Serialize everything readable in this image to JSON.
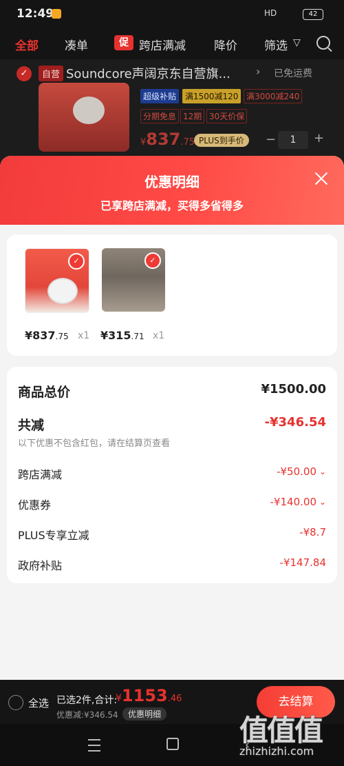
{
  "status": {
    "time": "12:49",
    "signal": "HD",
    "battery": "42"
  },
  "tabs": {
    "all": "全部",
    "combine": "凑单",
    "promo_badge": "促",
    "cross_store": "跨店满减",
    "price_drop": "降价",
    "filter": "筛选"
  },
  "background_item": {
    "self_tag": "自营",
    "shop_name": "Soundcore声阔京东自营旗...",
    "shipping": "已免运费",
    "tags": [
      "超级补贴",
      "满1500减120",
      "满3000减240",
      "分期免息",
      "12期",
      "30天价保"
    ],
    "price_symbol": "¥",
    "price_int": "837",
    "price_dec": ".75",
    "plus_badge": "PLUS到手价",
    "qty": "1",
    "minus": "−",
    "plus": "+"
  },
  "sheet": {
    "title": "优惠明细",
    "subtitle": "已享跨店满减，买得多省得多",
    "products": [
      {
        "price_main": "¥837",
        "price_dec": ".75",
        "qty": "x1"
      },
      {
        "price_main": "¥315",
        "price_dec": ".71",
        "qty": "x1"
      }
    ],
    "summary": {
      "total_label": "商品总价",
      "total_value": "¥1500.00",
      "reduce_label": "共减",
      "reduce_value": "-¥346.54",
      "note": "以下优惠不包含红包，请在结算页查看",
      "items": [
        {
          "label": "跨店满减",
          "value": "-¥50.00"
        },
        {
          "label": "优惠券",
          "value": "-¥140.00"
        },
        {
          "label": "PLUS专享立减",
          "value": "-¥8.7"
        },
        {
          "label": "政府补贴",
          "value": "-¥147.84"
        }
      ]
    }
  },
  "bottom": {
    "select_all": "全选",
    "selected_text": "已选2件,合计:",
    "total_symbol": "¥",
    "total_int": "1153",
    "total_dec": ".46",
    "discount_text": "优惠减:¥346.54",
    "detail_button": "优惠明细",
    "checkout_button": "去结算"
  },
  "watermark": {
    "glyphs": "值值值",
    "site": "zhizhizhi.com"
  },
  "colors": {
    "accent": "#e6322e",
    "sheet_header": "#f23b3b"
  }
}
